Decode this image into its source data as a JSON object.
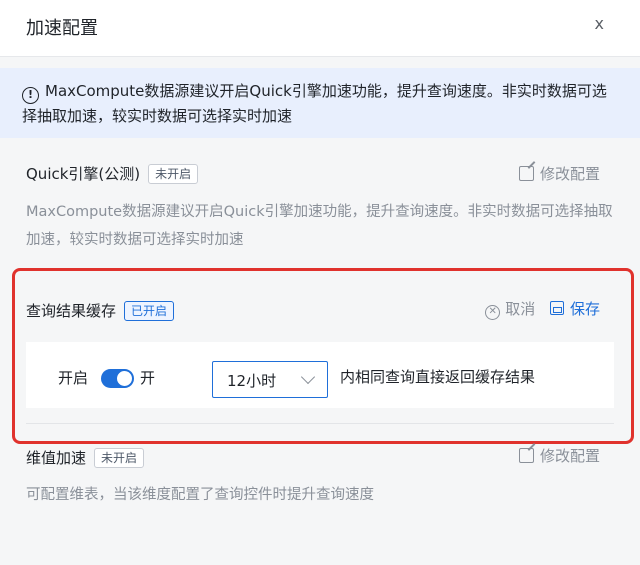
{
  "dialog": {
    "title": "加速配置",
    "close_label": "x"
  },
  "notice": {
    "icon": "info-icon",
    "text": "MaxCompute数据源建议开启Quick引擎加速功能，提升查询速度。非实时数据可选择抽取加速，较实时数据可选择实时加速"
  },
  "quick_engine": {
    "title": "Quick引擎(公测)",
    "status": "未开启",
    "edit_label": "修改配置",
    "description": "MaxCompute数据源建议开启Quick引擎加速功能，提升查询速度。非实时数据可选择抽取加速，较实时数据可选择实时加速"
  },
  "cache": {
    "title": "查询结果缓存",
    "status": "已开启",
    "cancel_label": "取消",
    "save_label": "保存",
    "row_label": "开启",
    "toggle_on": true,
    "toggle_text": "开",
    "select_value": "12小时",
    "select_suffix": "内相同查询直接返回缓存结果"
  },
  "dimension": {
    "title": "维值加速",
    "status": "未开启",
    "edit_label": "修改配置",
    "description": "可配置维表，当该维度配置了查询控件时提升查询速度"
  },
  "colors": {
    "accent": "#1f6fd9",
    "highlight_border": "#e0322d",
    "notice_bg": "#e8effd"
  }
}
